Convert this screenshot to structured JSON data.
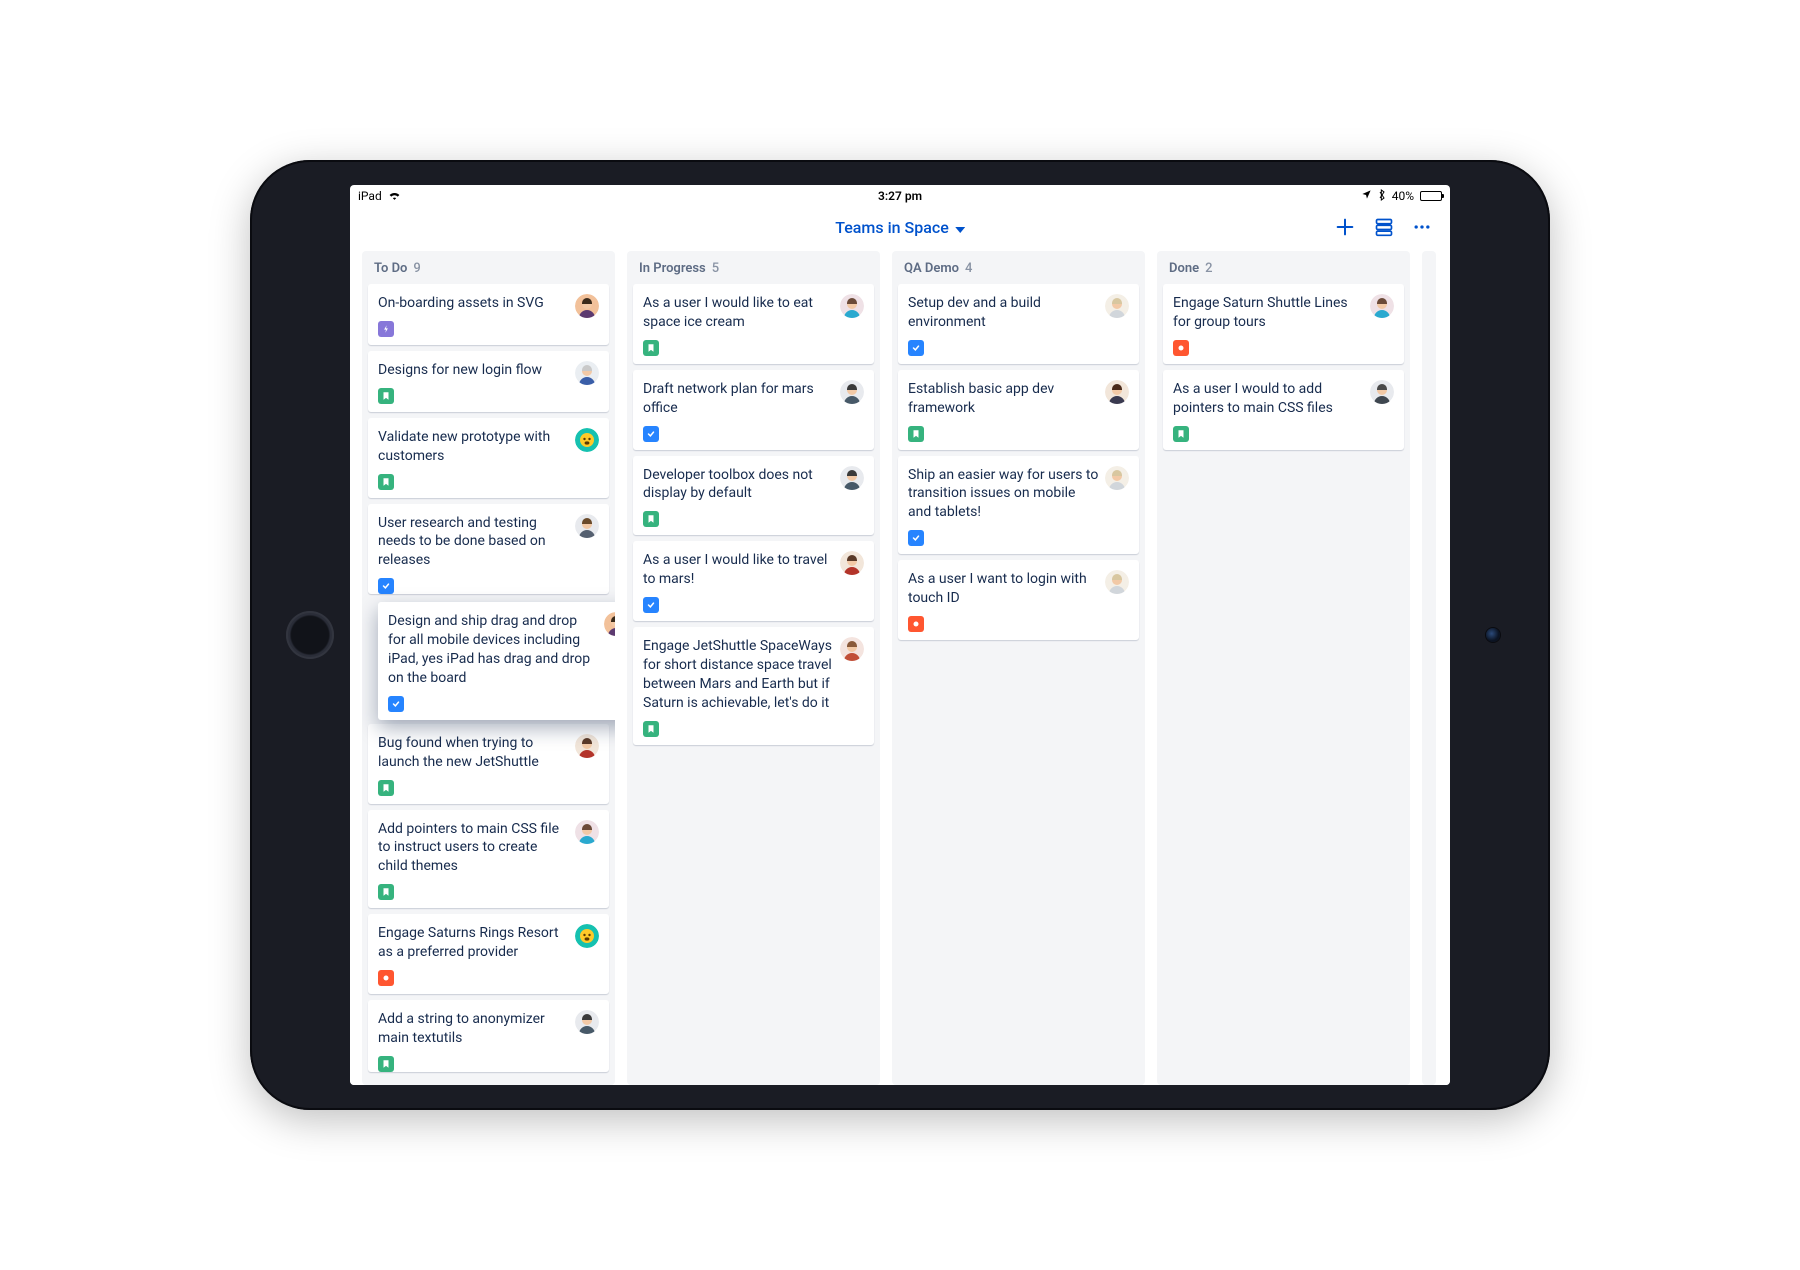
{
  "status_bar": {
    "device": "iPad",
    "time": "3:27 pm",
    "battery_pct": "40%"
  },
  "header": {
    "title": "Teams in Space"
  },
  "avatars": {
    "female1": {
      "bg": "#f2c19a",
      "hair": "#3a2a1a",
      "shirt": "#5c3a70"
    },
    "male1": {
      "bg": "#eaeef2",
      "hair": "#c9c9c9",
      "shirt": "#3a5ea8"
    },
    "emoji1": {
      "bg": "#16c1b0",
      "face": "#ffca28"
    },
    "male2": {
      "bg": "#e8eaee",
      "hair": "#6a4a2a",
      "shirt": "#556070"
    },
    "female2": {
      "bg": "#f2e6da",
      "hair": "#5a3a28",
      "shirt": "#b3342a"
    },
    "female3": {
      "bg": "#efe1e6",
      "hair": "#6b4a38",
      "shirt": "#2aa9cf"
    },
    "male3": {
      "bg": "#e8eaee",
      "hair": "#3a3a3a",
      "shirt": "#475968"
    },
    "female4": {
      "bg": "#f4e4df",
      "hair": "#8a5a3a",
      "shirt": "#c14f38"
    },
    "male4": {
      "bg": "#f4efe6",
      "hair": "#d8c7a0",
      "shirt": "#d1d6db"
    },
    "female5": {
      "bg": "#f2e6da",
      "hair": "#4a2a1a",
      "shirt": "#3a3a50"
    },
    "female6": {
      "bg": "#efe1e6",
      "hair": "#6b4a38",
      "shirt": "#2aa9cf"
    },
    "male5": {
      "bg": "#e8eaee",
      "hair": "#4a4a4a",
      "shirt": "#3f4750"
    }
  },
  "columns": [
    {
      "name": "To Do",
      "count": "9",
      "cards": [
        {
          "title": "On-boarding assets in SVG",
          "type": "epic",
          "avatar": "female1"
        },
        {
          "title": "Designs for new login flow",
          "type": "story",
          "avatar": "male1"
        },
        {
          "title": "Validate new prototype with customers",
          "type": "story",
          "avatar": "emoji1"
        },
        {
          "title": "User research and testing needs to be done based on releases",
          "type": "task",
          "avatar": "male2",
          "truncated": true
        },
        {
          "title": "Design and ship drag and drop for all mobile devices including iPad, yes iPad has drag and drop on the board",
          "type": "task",
          "avatar": "female1",
          "dragging": true
        },
        {
          "title": "Bug found when trying to launch the new JetShuttle",
          "type": "story",
          "avatar": "female2"
        },
        {
          "title": "Add pointers to main CSS file to instruct users to create child themes",
          "type": "story",
          "avatar": "female3"
        },
        {
          "title": "Engage Saturns Rings Resort as a preferred provider",
          "type": "bug",
          "avatar": "emoji1"
        },
        {
          "title": "Add a string to anonymizer main textutils",
          "type": "story",
          "avatar": "male3",
          "truncated": true
        }
      ]
    },
    {
      "name": "In Progress",
      "count": "5",
      "cards": [
        {
          "title": "As a user I would like to eat space ice cream",
          "type": "story",
          "avatar": "female3"
        },
        {
          "title": "Draft network plan for mars office",
          "type": "task",
          "avatar": "male3"
        },
        {
          "title": "Developer toolbox does not display by default",
          "type": "story",
          "avatar": "male3"
        },
        {
          "title": "As a user I would like to travel to mars!",
          "type": "task",
          "avatar": "female2"
        },
        {
          "title": "Engage JetShuttle SpaceWays for short distance space travel between Mars and Earth but if Saturn is achievable, let's do it",
          "type": "story",
          "avatar": "female4"
        }
      ]
    },
    {
      "name": "QA Demo",
      "count": "4",
      "cards": [
        {
          "title": "Setup dev and a build environment",
          "type": "task",
          "avatar": "male4"
        },
        {
          "title": "Establish basic app dev framework",
          "type": "story",
          "avatar": "female5"
        },
        {
          "title": "Ship an easier way for users to transition issues on mobile and tablets!",
          "type": "task",
          "avatar": "male4"
        },
        {
          "title": "As a user I want to login with touch ID",
          "type": "bug",
          "avatar": "male4"
        }
      ]
    },
    {
      "name": "Done",
      "count": "2",
      "cards": [
        {
          "title": "Engage Saturn Shuttle Lines for group tours",
          "type": "bug",
          "avatar": "female6"
        },
        {
          "title": "As a user I would to add pointers to main CSS files",
          "type": "story",
          "avatar": "male5"
        }
      ]
    }
  ]
}
